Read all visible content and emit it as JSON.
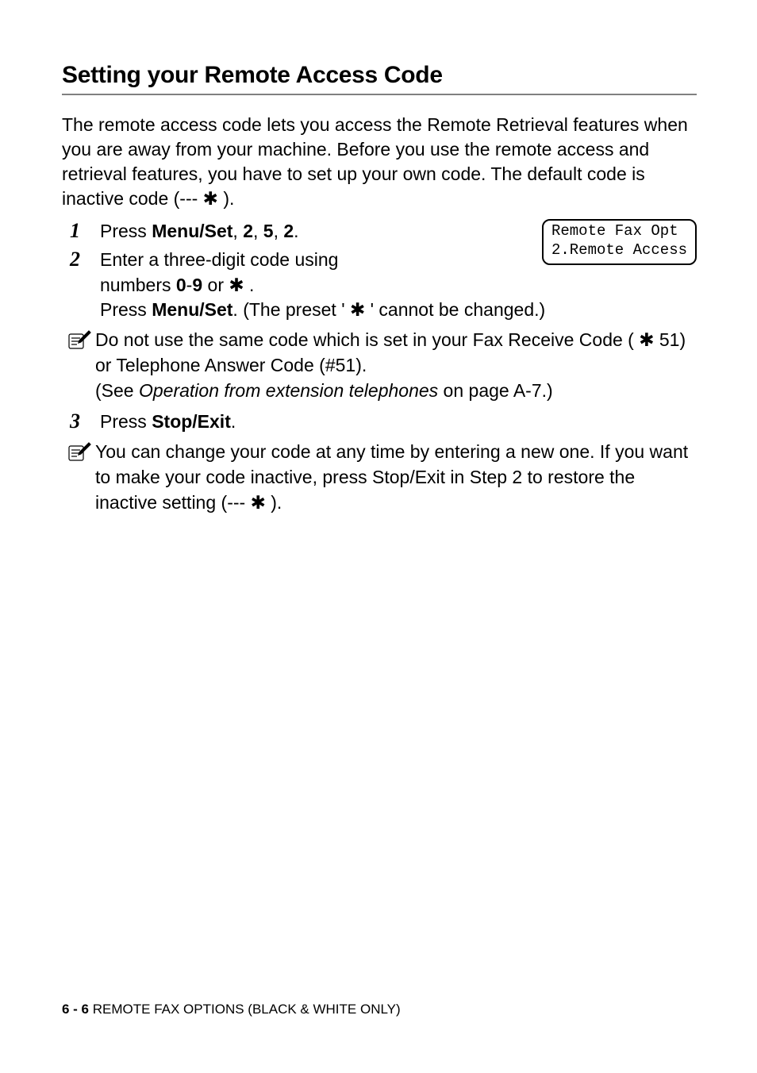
{
  "title": "Setting your Remote Access Code",
  "intro": {
    "line1": "The remote access code lets you access the Remote Retrieval features when you are away from your machine. Before you use the remote access and retrieval features, you have to set up your own code. The default code is inactive code (--- "
  },
  "star": "✱",
  "closeParen": " ).",
  "lcd": {
    "line1": "Remote Fax Opt",
    "line2": "2.Remote Access"
  },
  "steps": {
    "n1": "1",
    "s1_press": "Press ",
    "s1_menu": "Menu/Set",
    "s1_seq": ", ",
    "s1_2a": "2",
    "s1_5": "5",
    "s1_2b": "2",
    "s1_end": ".",
    "n2": "2",
    "s2_l1": "Enter a three-digit code using numbers ",
    "s2_09": "0",
    "s2_dash": "-",
    "s2_9": "9",
    "s2_or": " or ",
    "s2_dot": " .",
    "s2_l2_press": "Press ",
    "s2_l2_menuset": "Menu/Set",
    "s2_l2_rest": ". (The preset ' ",
    "s2_l2_rest2": " ' cannot be changed.)",
    "n3": "3",
    "s3_press": "Press ",
    "s3_stop": "Stop/Exit",
    "s3_end": "."
  },
  "note1": {
    "l1": "Do not use the same code which is set in your Fax Receive Code ( ",
    "code51": " 51",
    "l1b": ") or Telephone Answer Code (",
    "hash51": "#51",
    "l1c": ").",
    "l2a": "(See ",
    "l2italic": "Operation from extension telephones",
    "l2b": " on page A-7.)"
  },
  "note2": {
    "l1": "You can change your code at any time by entering a new one. If you want to make your code inactive, press ",
    "stopExit": "Stop/Exit",
    "l2": " in Step 2 to restore the inactive setting (--- ",
    "l3": " )."
  },
  "footer": {
    "page": "6 - 6",
    "sep": "   ",
    "title": "REMOTE FAX OPTIONS (BLACK & WHITE ONLY)"
  }
}
